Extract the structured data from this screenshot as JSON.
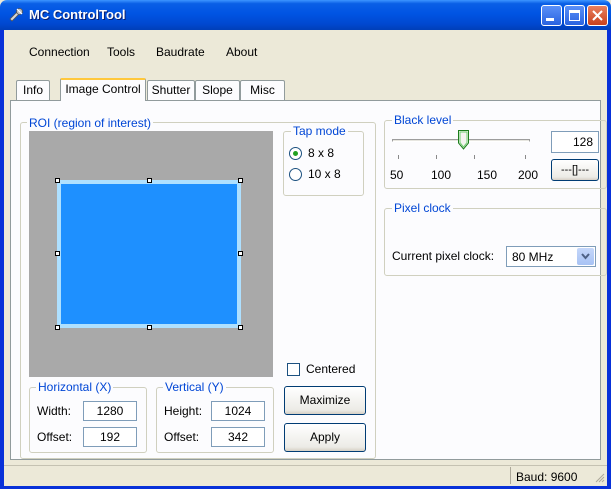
{
  "window": {
    "title": "MC ControlTool"
  },
  "menu": [
    "Connection",
    "Tools",
    "Baudrate",
    "About"
  ],
  "tabs": [
    "Info",
    "Image Control",
    "Shutter",
    "Slope",
    "Misc"
  ],
  "roi": {
    "title": "ROI (region of interest)",
    "horizontal": {
      "title": "Horizontal (X)",
      "width_label": "Width:",
      "width_value": "1280",
      "offset_label": "Offset:",
      "offset_value": "192"
    },
    "vertical": {
      "title": "Vertical (Y)",
      "height_label": "Height:",
      "height_value": "1024",
      "offset_label": "Offset:",
      "offset_value": "342"
    }
  },
  "tap_mode": {
    "title": "Tap mode",
    "options": [
      "8 x 8",
      "10 x 8"
    ],
    "selected": "8 x 8"
  },
  "centered": {
    "label": "Centered",
    "checked": false
  },
  "buttons": {
    "maximize": "Maximize",
    "apply": "Apply"
  },
  "black_level": {
    "title": "Black level",
    "value": "128",
    "slider_value": 128,
    "ticks": [
      "50",
      "100",
      "150",
      "200"
    ],
    "button_label": "---[]---"
  },
  "pixel_clock": {
    "title": "Pixel clock",
    "label": "Current pixel clock:",
    "value": "80 MHz"
  },
  "status": {
    "baud": "Baud: 9600"
  },
  "colors": {
    "titlebar": "#0054e3",
    "roi_fill": "#1e90ff",
    "roi_border": "#aee0ff",
    "group_title": "#0046d5",
    "radio_dot": "#21a121"
  }
}
